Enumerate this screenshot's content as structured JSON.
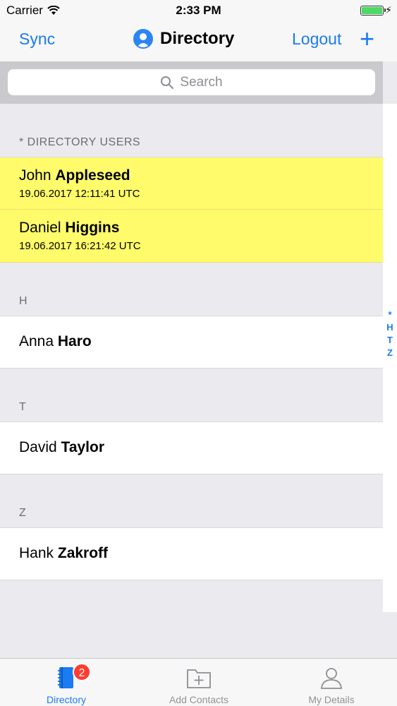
{
  "status": {
    "carrier": "Carrier",
    "time": "2:33 PM",
    "battery_level": 1.0
  },
  "nav": {
    "sync_label": "Sync",
    "title": "Directory",
    "logout_label": "Logout",
    "add_label": "+"
  },
  "search": {
    "placeholder": "Search"
  },
  "sections": [
    {
      "header": "* DIRECTORY USERS",
      "rows": [
        {
          "first": "John",
          "last": "Appleseed",
          "time": "19.06.2017 12:11:41 UTC"
        },
        {
          "first": "Daniel",
          "last": "Higgins",
          "time": "19.06.2017 16:21:42 UTC"
        }
      ]
    },
    {
      "header": "H",
      "rows": [
        {
          "first": "Anna",
          "last": "Haro"
        }
      ]
    },
    {
      "header": "T",
      "rows": [
        {
          "first": "David",
          "last": "Taylor"
        }
      ]
    },
    {
      "header": "Z",
      "rows": [
        {
          "first": "Hank",
          "last": "Zakroff"
        }
      ]
    }
  ],
  "index": [
    "*",
    "H",
    "T",
    "Z"
  ],
  "tabs": [
    {
      "label": "Directory",
      "icon": "directory-book-icon"
    },
    {
      "label": "Add Contacts",
      "icon": "folder-plus-icon"
    },
    {
      "label": "My Details",
      "icon": "person-icon"
    }
  ],
  "badge": "2",
  "colors": {
    "accent": "#1a7bf2",
    "highlight": "#fffb6b",
    "badge": "#ff3b30"
  }
}
